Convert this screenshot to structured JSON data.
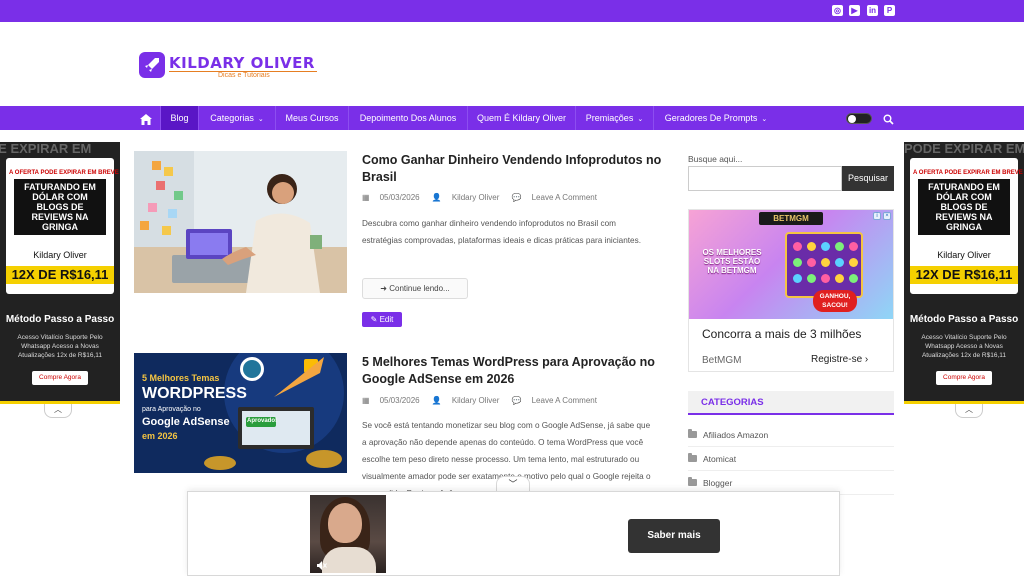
{
  "topbar": {
    "social_icons": [
      "instagram-icon",
      "youtube-icon",
      "linkedin-icon",
      "pinterest-icon"
    ],
    "social_glyphs": [
      "◎",
      "▶",
      "in",
      "P"
    ]
  },
  "header": {
    "logo_title": "KILDARY OLIVER",
    "logo_subtitle": "Dicas e Tutoriais"
  },
  "nav": {
    "items": [
      {
        "label": "Blog",
        "active": true
      },
      {
        "label": "Categorias",
        "dropdown": true
      },
      {
        "label": "Meus Cursos"
      },
      {
        "label": "Depoimento Dos Alunos"
      },
      {
        "label": "Quem É Kildary Oliver"
      },
      {
        "label": "Premiações",
        "dropdown": true
      },
      {
        "label": "Geradores De Prompts",
        "dropdown": true
      }
    ],
    "caret": "⌄"
  },
  "side_ad": {
    "top_text": "PODE EXPIRAR EM",
    "yellow_line": "A OFERTA PODE EXPIRAR EM BREVE",
    "headline": "FATURANDO EM DÓLAR COM BLOGS DE REVIEWS NA GRINGA",
    "name": "Kildary Oliver",
    "price": "12X DE R$16,11",
    "title": "Método Passo a Passo",
    "desc": "Acesso Vitalício Suporte Pelo Whatsapp Acesso a Novas Atualizações 12x de R$16,11",
    "cta": "Compre Agora",
    "collapse_glyph": "︿"
  },
  "posts": [
    {
      "title": "Como Ganhar Dinheiro Vendendo Infoprodutos no Brasil",
      "date": "05/03/2026",
      "author": "Kildary Oliver",
      "comments": "Leave A Comment",
      "excerpt": "Descubra como ganhar dinheiro vendendo infoprodutos no Brasil com estratégias comprovadas, plataformas ideais e dicas práticas para iniciantes.",
      "continue": "Continue lendo...",
      "edit": "Edit"
    },
    {
      "title": "5 Melhores Temas WordPress para Aprovação no Google AdSense em 2026",
      "date": "05/03/2026",
      "author": "Kildary Oliver",
      "comments": "Leave A Comment",
      "excerpt": "Se você está tentando monetizar seu blog com o Google AdSense, já sabe que a aprovação não depende apenas do conteúdo. O tema WordPress que você escolhe tem peso direto nesse processo. Um tema lento, mal estruturado ou visualmente amador pode ser exatamente o motivo pelo qual o Google rejeita o seu pedido. Por isso, [...]",
      "image_text": {
        "line1": "5 Melhores Temas",
        "line2": "WORDPRESS",
        "line3": "para Aprovação no",
        "line4": "Google AdSense",
        "line5": "em 2026",
        "approved": "Aprovado!"
      }
    }
  ],
  "sidebar": {
    "search_label": "Busque aqui...",
    "search_placeholder": "",
    "search_button": "Pesquisar",
    "bet_ad": {
      "logo": "BETMGM",
      "promo": "OS MELHORES SLOTS ESTÃO NA BETMGM",
      "burst": "GANHOU, SACOU!",
      "headline": "Concorra a mais de 3 milhões",
      "brand": "BetMGM",
      "register": "Registre-se ›"
    },
    "categories_title": "CATEGORIAS",
    "categories": [
      "Afiliados Amazon",
      "Atomicat",
      "Blogger"
    ]
  },
  "bottom_ad": {
    "collapse_glyph": "﹀",
    "button": "Saber mais"
  },
  "colors": {
    "brand": "#7a2fe8",
    "brand_dark": "#5a16c6",
    "accent": "#e67e22"
  }
}
